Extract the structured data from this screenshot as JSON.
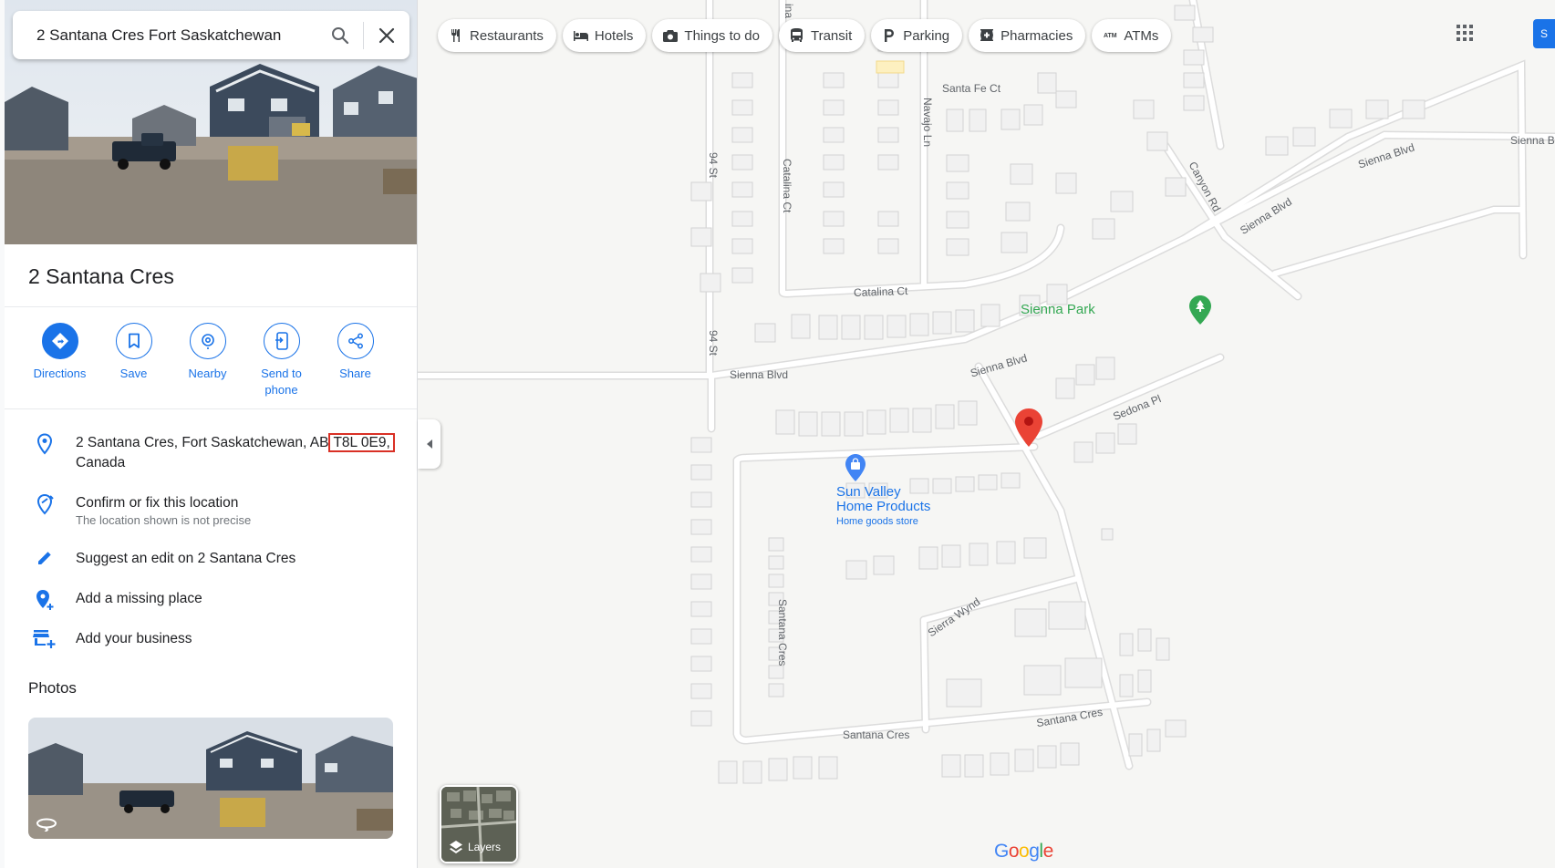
{
  "search": {
    "query": "2 Santana Cres Fort Saskatchewan",
    "search_icon": "search-icon",
    "close_icon": "close-icon"
  },
  "place": {
    "title": "2 Santana Cres"
  },
  "actions": [
    {
      "label": "Directions",
      "icon": "directions-icon"
    },
    {
      "label": "Save",
      "icon": "bookmark-icon"
    },
    {
      "label": "Nearby",
      "icon": "nearby-icon"
    },
    {
      "label": "Send to phone",
      "icon": "send-to-phone-icon"
    },
    {
      "label": "Share",
      "icon": "share-icon"
    }
  ],
  "details": {
    "address_prefix": "2 Santana Cres, Fort Saskatchewan, AB",
    "address_zip": "T8L 0E9,",
    "address_country": "Canada",
    "confirm_title": "Confirm or fix this location",
    "confirm_sub": "The location shown is not precise",
    "suggest_edit": "Suggest an edit on 2 Santana Cres",
    "add_missing": "Add a missing place",
    "add_business": "Add your business"
  },
  "photos": {
    "heading": "Photos"
  },
  "map": {
    "chips": [
      {
        "label": "Restaurants",
        "icon": "restaurant-icon"
      },
      {
        "label": "Hotels",
        "icon": "hotel-icon"
      },
      {
        "label": "Things to do",
        "icon": "camera-icon"
      },
      {
        "label": "Transit",
        "icon": "transit-icon"
      },
      {
        "label": "Parking",
        "icon": "parking-icon"
      },
      {
        "label": "Pharmacies",
        "icon": "pharmacy-icon"
      },
      {
        "label": "ATMs",
        "icon": "atm-icon"
      }
    ],
    "signin_label": "S",
    "layers_label": "Layers",
    "logo": "Google",
    "streets": {
      "santa_fe_ct": "Santa Fe Ct",
      "navajo_ln": "Navajo Ln",
      "st94_top": "94 St",
      "catalina_ct_v": "Catalina Ct",
      "catalina_ct_h": "Catalina Ct",
      "st94_bottom": "94 St",
      "sienna_blvd_left": "Sienna Blvd",
      "sienna_blvd_mid": "Sienna Blvd",
      "sienna_blvd_right1": "Sienna Blvd",
      "sienna_blvd_right2": "Sienna Blvd",
      "sienna_edge": "Sienna B",
      "canyon_rd": "Canyon Rd",
      "sedona_pl": "Sedona Pl",
      "sierra_wynd": "Sierra Wynd",
      "santana_cres_v": "Santana Cres",
      "santana_cres_h1": "Santana Cres",
      "santana_cres_h2": "Santana Cres",
      "partial_top": "ina"
    },
    "pois": {
      "park": "Sienna Park",
      "store_name_1": "Sun Valley",
      "store_name_2": "Home Products",
      "store_type": "Home goods store"
    }
  }
}
